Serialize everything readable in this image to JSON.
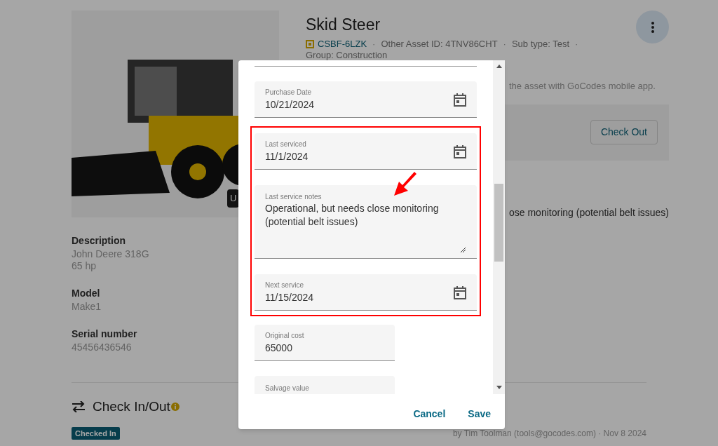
{
  "asset": {
    "title": "Skid Steer",
    "image_button": "U",
    "code": "CSBF-6LZK",
    "meta": [
      {
        "separator": "·",
        "text": "Other Asset ID: 4TNV86CHT"
      },
      {
        "separator": "·",
        "text": "Sub type: Test"
      },
      {
        "separator": "·",
        "text": "Group: Construction"
      }
    ],
    "mobile_hint": "the asset with GoCodes mobile app.",
    "check_out_button": "Check Out",
    "notes_excerpt": "ose monitoring (potential belt issues)"
  },
  "details": [
    {
      "label": "Description",
      "value": "John Deere 318G\n65 hp"
    },
    {
      "label": "Model",
      "value": "Make1"
    },
    {
      "label": "Serial number",
      "value": "45456436546"
    }
  ],
  "check_section": {
    "title": "Check In/Out",
    "status": "Checked In",
    "footer": "by Tim Toolman (tools@gocodes.com) · Nov 8 2024"
  },
  "dialog": {
    "fields_above": [
      {
        "kind": "date",
        "label": "Purchase Date",
        "value": "10/21/2024"
      }
    ],
    "highlighted_fields": [
      {
        "kind": "date",
        "label": "Last serviced",
        "value": "11/1/2024"
      },
      {
        "kind": "textarea",
        "label": "Last service notes",
        "value": "Operational, but needs close monitoring (potential belt issues)"
      },
      {
        "kind": "date",
        "label": "Next service",
        "value": "11/15/2024"
      }
    ],
    "fields_below": [
      {
        "kind": "number",
        "label": "Original cost",
        "value": "65000"
      },
      {
        "kind": "number",
        "label": "Salvage value"
      }
    ],
    "buttons": [
      "Cancel",
      "Save"
    ]
  }
}
